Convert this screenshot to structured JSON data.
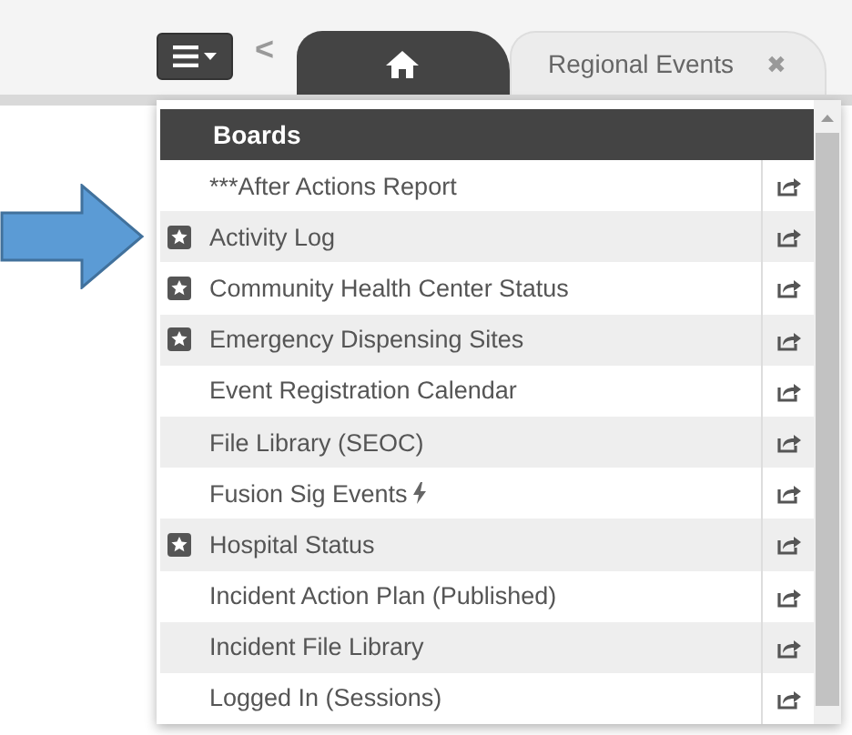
{
  "toolbar": {
    "back": "<",
    "tabs": [
      {
        "kind": "home",
        "selected": true
      },
      {
        "kind": "text",
        "label": "Regional Events",
        "close": "✖",
        "selected": false
      }
    ]
  },
  "boards_menu": {
    "title": "Boards",
    "items": [
      {
        "label": "***After Actions Report",
        "starred": false,
        "lightning": false
      },
      {
        "label": "Activity Log",
        "starred": true,
        "lightning": false
      },
      {
        "label": "Community Health Center Status",
        "starred": true,
        "lightning": false
      },
      {
        "label": "Emergency Dispensing Sites",
        "starred": true,
        "lightning": false
      },
      {
        "label": "Event Registration Calendar",
        "starred": false,
        "lightning": false
      },
      {
        "label": "File Library (SEOC)",
        "starred": false,
        "lightning": false
      },
      {
        "label": "Fusion Sig Events",
        "starred": false,
        "lightning": true
      },
      {
        "label": "Hospital Status",
        "starred": true,
        "lightning": false
      },
      {
        "label": "Incident Action Plan (Published)",
        "starred": false,
        "lightning": false
      },
      {
        "label": "Incident File Library",
        "starred": false,
        "lightning": false
      },
      {
        "label": "Logged In (Sessions)",
        "starred": false,
        "lightning": false
      }
    ]
  }
}
